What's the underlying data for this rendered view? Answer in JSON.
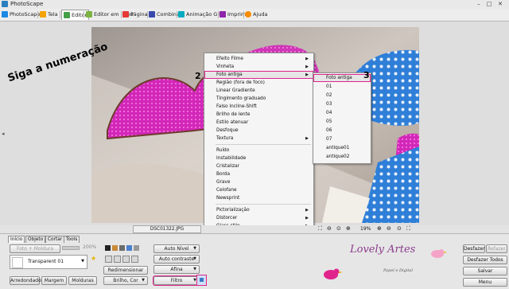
{
  "window": {
    "title": "PhotoScape"
  },
  "toolbar": {
    "items": [
      {
        "label": "PhotoScape",
        "color": "#1e88e5"
      },
      {
        "label": "Tela",
        "color": "#f4a300"
      },
      {
        "label": "Editor",
        "color": "#43a047"
      },
      {
        "label": "Editor em lotes",
        "color": "#7cb342"
      },
      {
        "label": "Página",
        "color": "#e53935"
      },
      {
        "label": "Combine",
        "color": "#3949ab"
      },
      {
        "label": "Animação Gif",
        "color": "#00acc1"
      },
      {
        "label": "Imprimir",
        "color": "#8e24aa"
      },
      {
        "label": "Ajuda",
        "color": "#fb8c00"
      }
    ]
  },
  "annotations": {
    "instruction": "Siga a numeração",
    "step1": "1",
    "step2": "2",
    "step3": "3",
    "highlight_color": "#e0248c"
  },
  "filter_menu": {
    "items": [
      {
        "label": "Efeito Filme",
        "submenu": true
      },
      {
        "label": "Vinheta",
        "submenu": true
      },
      {
        "label": "Foto antiga",
        "submenu": true,
        "highlighted": true
      },
      {
        "label": "Região (fora de foco)",
        "submenu": false
      },
      {
        "label": "Linear Gradiente",
        "submenu": false
      },
      {
        "label": "Tingimento graduado",
        "submenu": false
      },
      {
        "label": "Falso Incline-Shift",
        "submenu": false
      },
      {
        "label": "Brilho de lente",
        "submenu": false
      },
      {
        "label": "Estilo atenuar",
        "submenu": false
      },
      {
        "label": "Desfoque",
        "submenu": false
      },
      {
        "label": "Textura",
        "submenu": true
      },
      {
        "separator": true
      },
      {
        "label": "Ruído",
        "submenu": false
      },
      {
        "label": "Instabilidade",
        "submenu": false
      },
      {
        "label": "Cristalizar",
        "submenu": false
      },
      {
        "label": "Borda",
        "submenu": false
      },
      {
        "label": "Grave",
        "submenu": false
      },
      {
        "label": "Celofane",
        "submenu": false
      },
      {
        "label": "Newsprint",
        "submenu": false
      },
      {
        "separator": true
      },
      {
        "label": "Pictorialização",
        "submenu": true
      },
      {
        "label": "Distorcer",
        "submenu": true
      },
      {
        "label": "Glass stile",
        "submenu": true
      },
      {
        "label": "Faça uma caixa",
        "submenu": true
      },
      {
        "label": "Reflexão",
        "submenu": false
      },
      {
        "separator": true
      },
      {
        "label": "Desfoque Inteligente (Apaga Visual)",
        "submenu": false
      },
      {
        "label": "Redução de Ruído (Apaga Visual)",
        "submenu": true
      }
    ]
  },
  "submenu": {
    "items": [
      "Foto antiga",
      "01",
      "02",
      "03",
      "04",
      "05",
      "06",
      "07",
      "antique01",
      "antique02"
    ],
    "highlighted_index": 0
  },
  "status": {
    "filename": "DSC01322.JPG",
    "zoom": "19%"
  },
  "bottom_panel": {
    "tabs": [
      "Início",
      "Objeto",
      "Cortar",
      "Ferramentas"
    ],
    "tabs_visible": [
      "Início",
      "Objeto",
      "Cortar",
      "Tools"
    ],
    "frame_button": "Foto + Moldura",
    "frame_size": "200%",
    "frame_name": "Transparent 01",
    "buttons_left": [
      "Arredondado",
      "Margem",
      "Molduras"
    ],
    "redimensionar": "Redimensionar",
    "brilho": "Brilho, Cor",
    "auto_nivel": "Auto Nível",
    "auto_contraste": "Auto contraste",
    "afina": "Afina",
    "filtro": "Filtro"
  },
  "right_panel": {
    "desfazer": "Desfazer",
    "refazer": "Refazer",
    "desfazer_todos": "Desfazer Todos",
    "salvar": "Salvar",
    "menu": "Menu"
  },
  "logo": {
    "title": "Lovely Artes",
    "subtitle": "Papel e Digital"
  }
}
